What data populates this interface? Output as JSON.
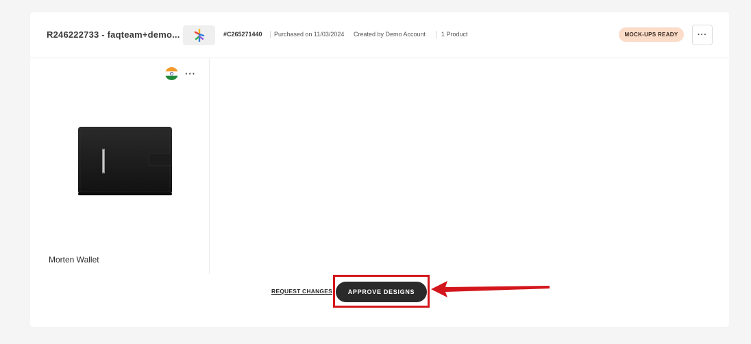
{
  "order": {
    "id_label": "R246222733 - faqteam+demo...",
    "code": "#C265271440",
    "purchased": "Purchased on 11/03/2024",
    "created_by": "Created by Demo Account",
    "product_count": "1 Product",
    "status_badge": "MOCK-UPS READY",
    "more_label": "···"
  },
  "product": {
    "name": "Morten Wallet",
    "flag_icon": "india-flag-icon",
    "more_label": "···"
  },
  "actions": {
    "request_changes": "REQUEST CHANGES",
    "approve_designs": "APPROVE DESIGNS"
  },
  "colors": {
    "badge_bg": "#fbdcc8",
    "highlight": "#d3161b",
    "button_dark": "#2a2a2a"
  }
}
